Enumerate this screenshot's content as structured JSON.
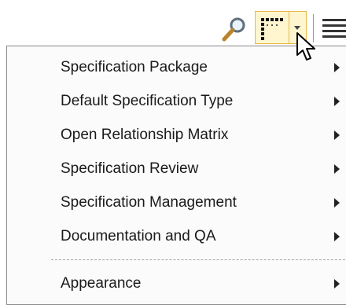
{
  "toolbar": {
    "icons": [
      "search-icon",
      "matrix-view-icon",
      "dropdown-arrow-icon",
      "menu-lines-icon"
    ],
    "highlight_color": "#fff6cf",
    "highlight_border": "#e6b84a"
  },
  "menu": {
    "items": [
      {
        "label": "Specification Package"
      },
      {
        "label": "Default Specification Type"
      },
      {
        "label": "Open Relationship Matrix"
      },
      {
        "label": "Specification Review"
      },
      {
        "label": "Specification Management"
      },
      {
        "label": "Documentation and QA"
      },
      {
        "label": "Appearance"
      }
    ]
  }
}
